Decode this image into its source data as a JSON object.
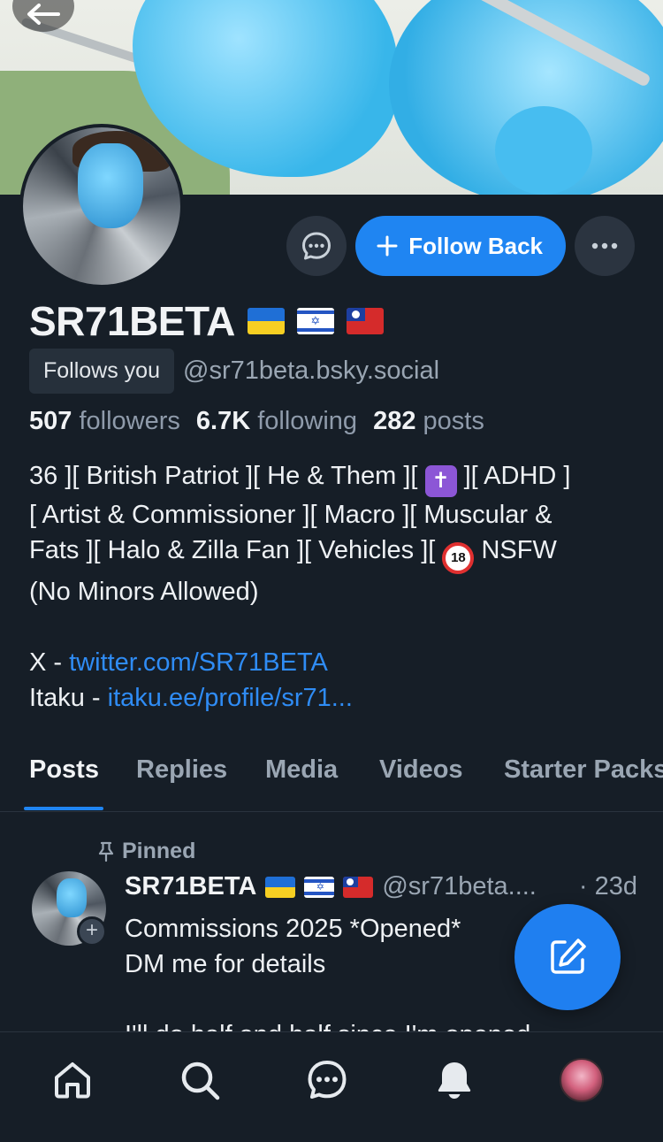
{
  "profile": {
    "display_name": "SR71BETA",
    "flags": [
      "ukraine-flag",
      "israel-flag",
      "taiwan-flag"
    ],
    "follows_you": "Follows you",
    "handle": "@sr71beta.bsky.social",
    "stats": {
      "followers_count": "507",
      "followers_label": "followers",
      "following_count": "6.7K",
      "following_label": "following",
      "posts_count": "282",
      "posts_label": "posts"
    },
    "bio": {
      "line1_a": "36 ][ British Patriot ][ He & Them ][ ",
      "line1_b": " ][ ADHD ]",
      "line2": "[ Artist & Commissioner ][ Macro ][ Muscular &",
      "line3_a": "Fats ][ Halo & Zilla Fan ][ Vehicles ][ ",
      "line3_b": " NSFW",
      "line4": "(No Minors Allowed)",
      "link1_prefix": "X - ",
      "link1_text": "twitter.com/SR71BETA",
      "link2_prefix": "Itaku - ",
      "link2_text": "itaku.ee/profile/sr71..."
    }
  },
  "actions": {
    "follow_back_label": "Follow Back"
  },
  "tabs": [
    "Posts",
    "Replies",
    "Media",
    "Videos",
    "Starter Packs"
  ],
  "active_tab": "Posts",
  "pinned_post": {
    "pinned_label": "Pinned",
    "author_name": "SR71BETA",
    "author_handle": "@sr71beta....",
    "timestamp": "· 23d",
    "lines": [
      "Commissions 2025 *Opened*",
      "DM me for details",
      "",
      "I'll do half and half since I'm opened"
    ]
  },
  "bottom_nav": [
    "home-icon",
    "search-icon",
    "chat-icon",
    "bell-icon",
    "profile-avatar"
  ],
  "colors": {
    "background": "#161e27",
    "accent": "#1f85f2",
    "link": "#2f8cf5",
    "muted_text": "#9aa6b3"
  }
}
